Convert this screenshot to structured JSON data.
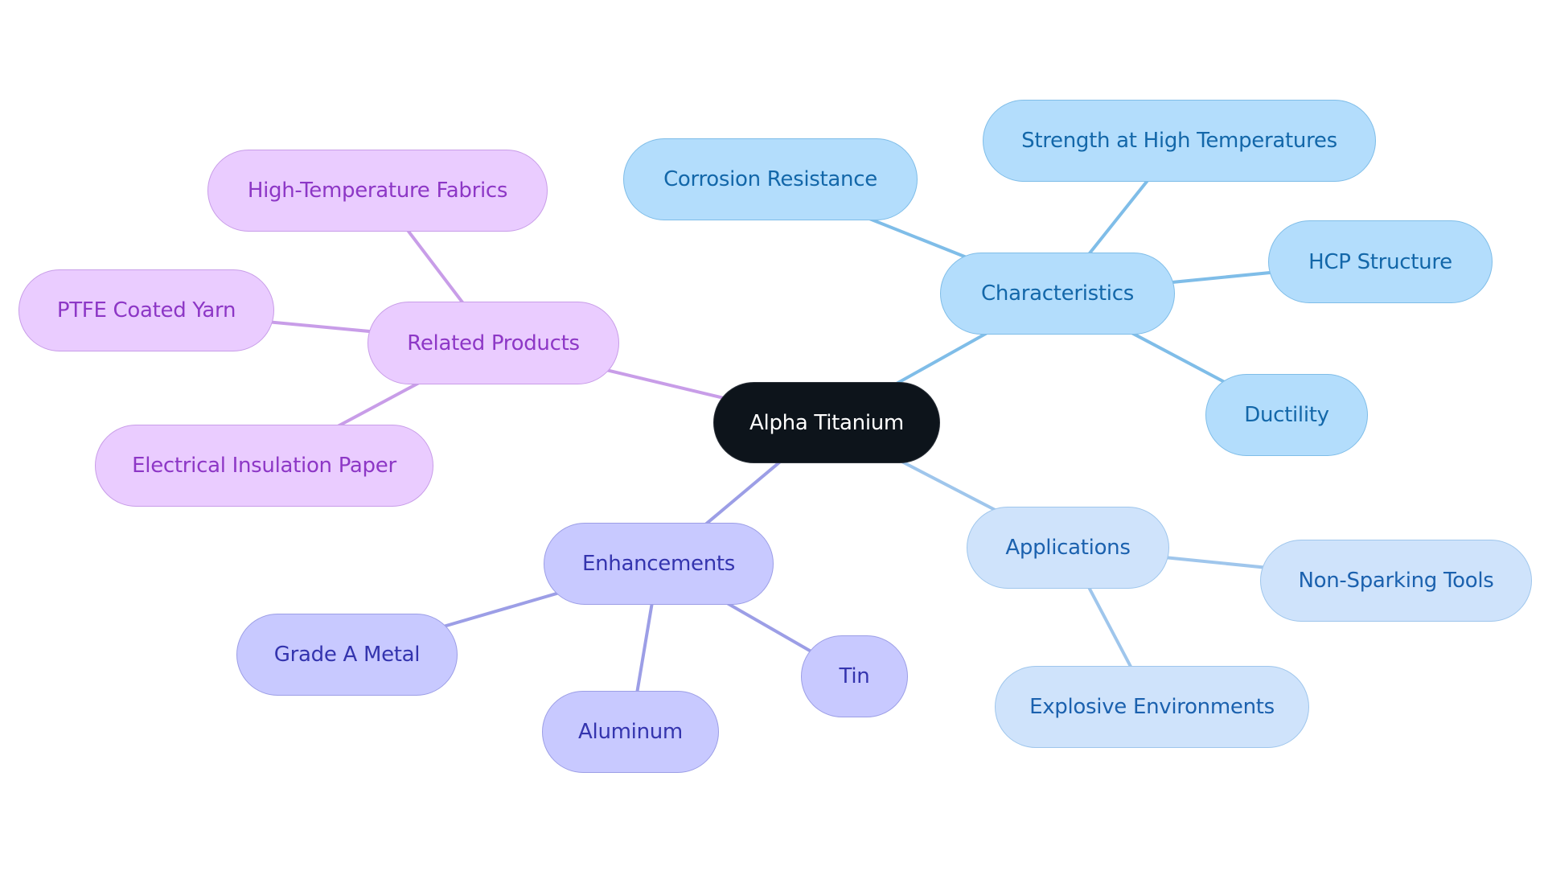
{
  "mindmap": {
    "root": {
      "id": "root",
      "label": "Alpha Titanium"
    },
    "branches": [
      {
        "id": "characteristics",
        "label": "Characteristics",
        "color": "#7fbde8",
        "children": [
          {
            "id": "corrosion",
            "label": "Corrosion Resistance"
          },
          {
            "id": "strength",
            "label": "Strength at High Temperatures"
          },
          {
            "id": "hcp",
            "label": "HCP Structure"
          },
          {
            "id": "ductility",
            "label": "Ductility"
          }
        ]
      },
      {
        "id": "applications",
        "label": "Applications",
        "color": "#9fc6ec",
        "children": [
          {
            "id": "nonsparking",
            "label": "Non-Sparking Tools"
          },
          {
            "id": "explosive",
            "label": "Explosive Environments"
          }
        ]
      },
      {
        "id": "enhancements",
        "label": "Enhancements",
        "color": "#9c9ee6",
        "children": [
          {
            "id": "gradea",
            "label": "Grade A Metal"
          },
          {
            "id": "aluminum",
            "label": "Aluminum"
          },
          {
            "id": "tin",
            "label": "Tin"
          }
        ]
      },
      {
        "id": "related",
        "label": "Related Products",
        "color": "#c89de8",
        "children": [
          {
            "id": "fabrics",
            "label": "High-Temperature Fabrics"
          },
          {
            "id": "ptfe",
            "label": "PTFE Coated Yarn"
          },
          {
            "id": "paper",
            "label": "Electrical Insulation Paper"
          }
        ]
      }
    ]
  }
}
